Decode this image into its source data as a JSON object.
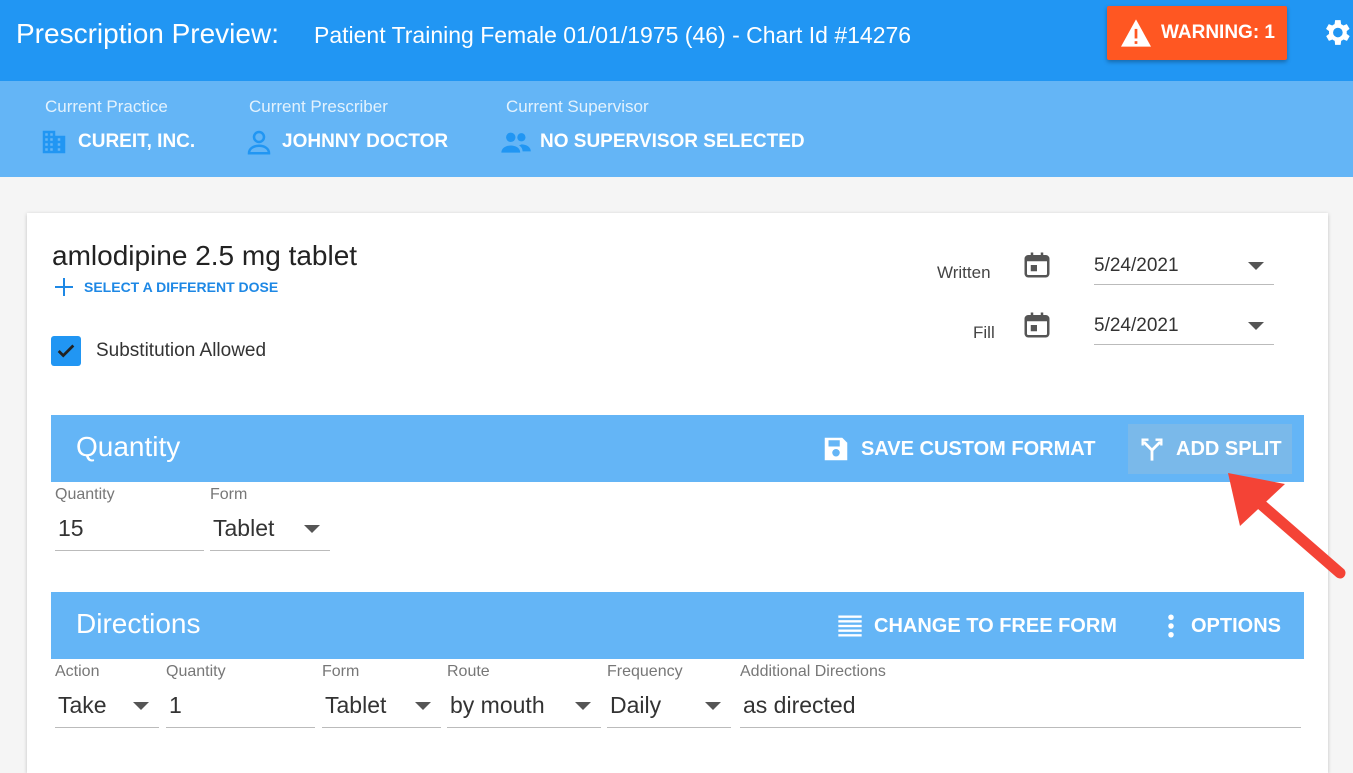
{
  "header": {
    "title": "Prescription Preview:",
    "patient": "Patient Training Female 01/01/1975 (46) - Chart Id #14276",
    "warning_label": "WARNING: 1",
    "warning_color": "#ff5722",
    "settings_icon": "gear-icon"
  },
  "context": {
    "practice_label": "Current Practice",
    "practice_value": "CUREIT, INC.",
    "prescriber_label": "Current Prescriber",
    "prescriber_value": "JOHNNY DOCTOR",
    "supervisor_label": "Current Supervisor",
    "supervisor_value": "NO SUPERVISOR SELECTED"
  },
  "drug": {
    "name": "amlodipine 2.5 mg tablet",
    "select_dose_label": "SELECT A DIFFERENT DOSE",
    "substitution_label": "Substitution Allowed",
    "substitution_checked": true
  },
  "dates": {
    "written_label": "Written",
    "written_value": "5/24/2021",
    "fill_label": "Fill",
    "fill_value": "5/24/2021"
  },
  "quantity_section": {
    "title": "Quantity",
    "save_format_label": "SAVE CUSTOM FORMAT",
    "add_split_label": "ADD SPLIT",
    "quantity_label": "Quantity",
    "quantity_value": "15",
    "form_label": "Form",
    "form_value": "Tablet"
  },
  "directions_section": {
    "title": "Directions",
    "free_form_label": "CHANGE TO FREE FORM",
    "options_label": "OPTIONS",
    "action_label": "Action",
    "action_value": "Take",
    "quantity_label": "Quantity",
    "quantity_value": "1",
    "form_label": "Form",
    "form_value": "Tablet",
    "route_label": "Route",
    "route_value": "by mouth",
    "frequency_label": "Frequency",
    "frequency_value": "Daily",
    "additional_label": "Additional Directions",
    "additional_value": "as directed"
  },
  "colors": {
    "primary": "#2196f3",
    "band": "#64b5f6",
    "annotation_arrow": "#f44336"
  }
}
